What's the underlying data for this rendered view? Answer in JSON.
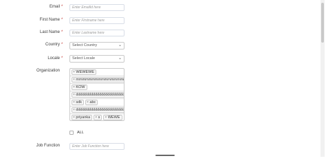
{
  "form": {
    "email": {
      "label": "Email",
      "required": "*",
      "placeholder": "Enter EmailId here"
    },
    "first_name": {
      "label": "First Name",
      "required": "*",
      "placeholder": "Enter Firstname here"
    },
    "last_name": {
      "label": "Last Name",
      "required": "*",
      "placeholder": "Enter Lastname here"
    },
    "country": {
      "label": "Country",
      "required": "*",
      "value": "Select Country"
    },
    "locale": {
      "label": "Locale",
      "required": "*",
      "value": "Select Locale"
    },
    "organization": {
      "label": "Organization",
      "rows": [
        [
          "WEWEWE"
        ],
        [
          "mmmmmmmmmmmmmmmmmmmmmm"
        ],
        [
          "KOW"
        ],
        [
          "ddddddddddddddddddddddddd"
        ],
        [
          "sdk",
          "abc"
        ],
        [
          "ddddddddddddddddddddddddd"
        ],
        [
          "priyanka",
          "s",
          "WEWE"
        ]
      ],
      "remove_glyph": "×"
    },
    "all_checkbox": {
      "label": "ALL",
      "checked": false
    },
    "job_function": {
      "label": "Job Function",
      "placeholder": "Enter Job Function here"
    }
  },
  "icons": {
    "select_chevron": "chevron-down-icon",
    "pill_remove": "close-icon"
  }
}
